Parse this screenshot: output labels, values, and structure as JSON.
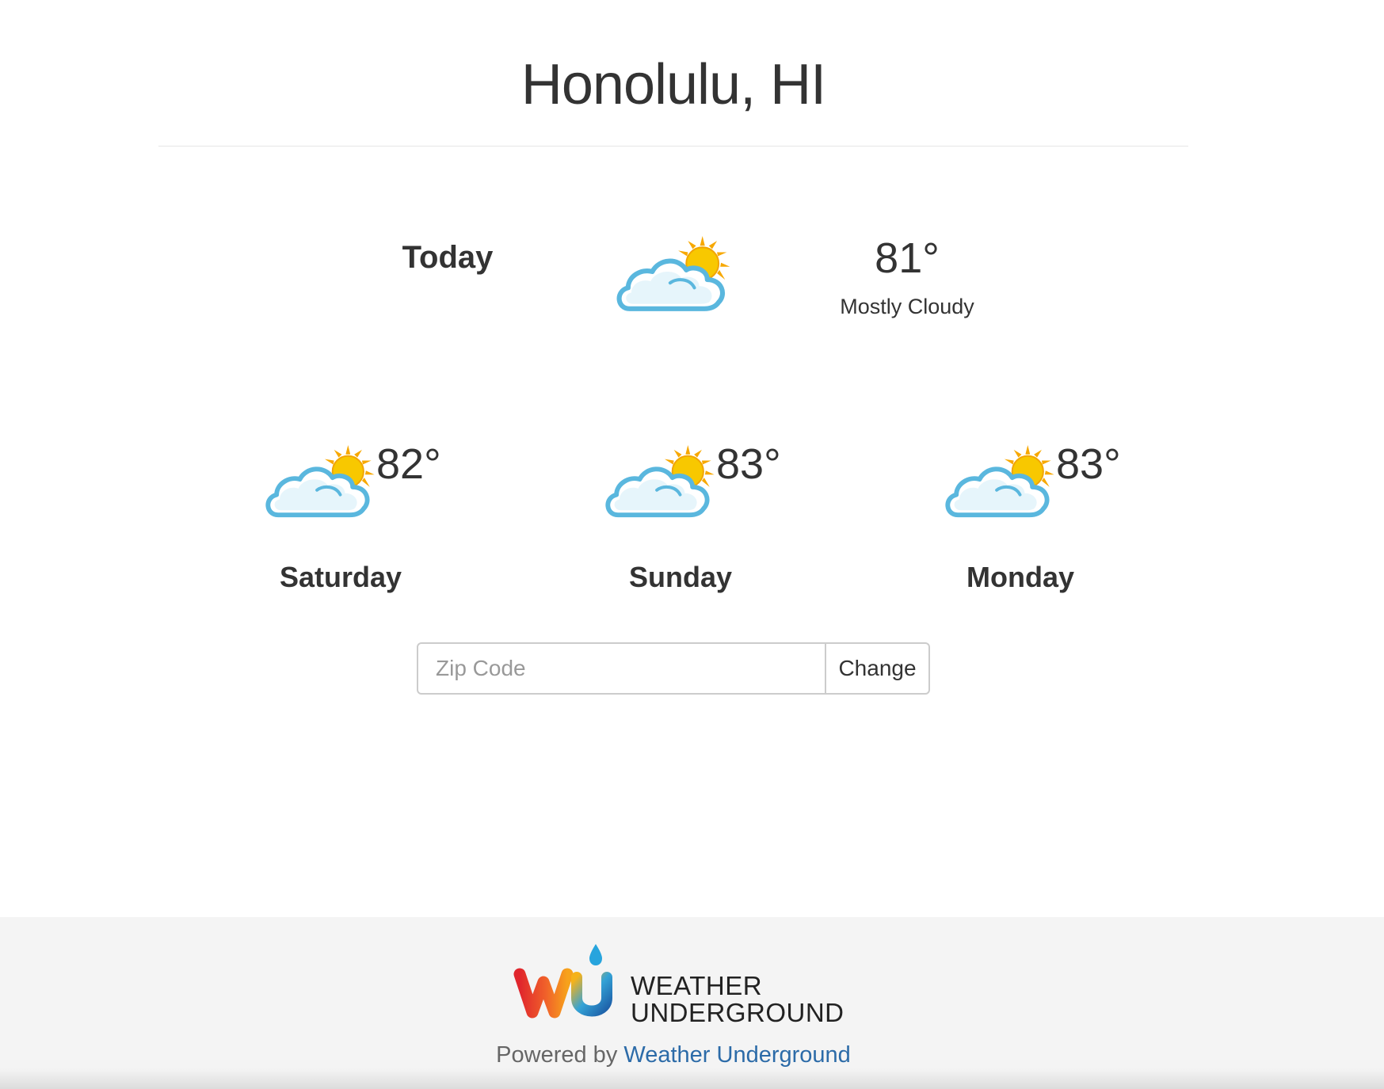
{
  "location": {
    "title": "Honolulu, HI"
  },
  "today": {
    "label": "Today",
    "icon": "mostly-cloudy-icon",
    "temp": "81°",
    "condition": "Mostly Cloudy"
  },
  "forecast": [
    {
      "day": "Saturday",
      "temp": "82°",
      "icon": "mostly-cloudy-icon"
    },
    {
      "day": "Sunday",
      "temp": "83°",
      "icon": "mostly-cloudy-icon"
    },
    {
      "day": "Monday",
      "temp": "83°",
      "icon": "mostly-cloudy-icon"
    }
  ],
  "zip_form": {
    "placeholder": "Zip Code",
    "value": "",
    "button_label": "Change"
  },
  "footer": {
    "logo_line1": "WEATHER",
    "logo_line2": "UNDERGROUND",
    "powered_prefix": "Powered by",
    "powered_link": "Weather Underground"
  },
  "colors": {
    "link": "#2c6ba8",
    "footer_bg": "#f4f4f4",
    "text": "#333333",
    "cloud_outline": "#5ab7de",
    "sun": "#f7c600"
  }
}
